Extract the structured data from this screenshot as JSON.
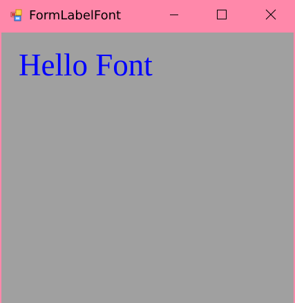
{
  "window": {
    "title": "FormLabelFont",
    "app_icon": "windows-form-icon",
    "titlebar_color": "#ff88aa",
    "client_bg_color": "#a0a0a0"
  },
  "controls": {
    "minimize_icon": "minimize-icon",
    "maximize_icon": "maximize-icon",
    "close_icon": "close-icon"
  },
  "label": {
    "text": "Hello Font",
    "color": "#0000ff"
  }
}
